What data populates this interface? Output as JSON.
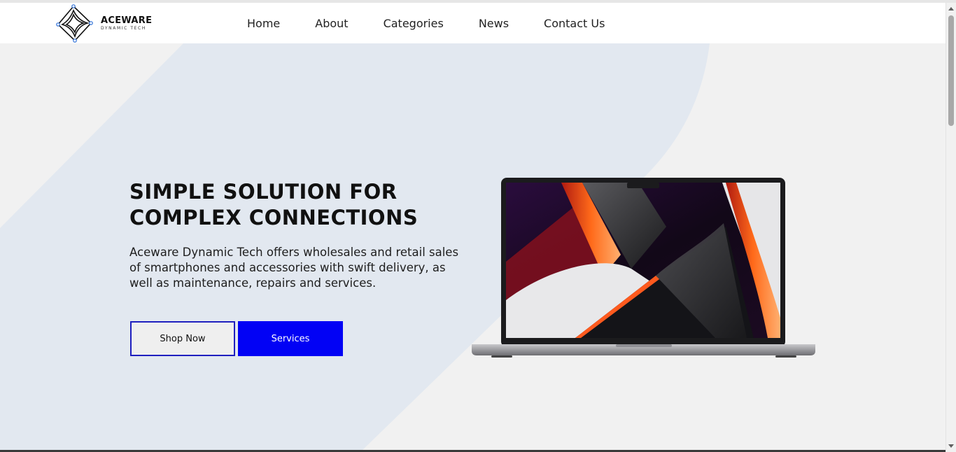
{
  "brand": {
    "name": "ACEWARE",
    "tagline": "DYNAMIC TECH"
  },
  "nav": {
    "items": [
      "Home",
      "About",
      "Categories",
      "News",
      "Contact Us"
    ]
  },
  "hero": {
    "headline_line1": "SIMPLE SOLUTION FOR",
    "headline_line2": "COMPLEX CONNECTIONS",
    "description": "Aceware Dynamic Tech offers wholesales and retail sales of smartphones and accessories with swift delivery, as well as maintenance, repairs and services.",
    "shop_button": "Shop Now",
    "services_button": "Services"
  },
  "colors": {
    "accent": "#0202f5",
    "outline": "#1f1fbf",
    "hero_shape": "#e2e8f0",
    "background": "#f1f1f1"
  },
  "icons": {
    "logo": "diamond-circuit-logo",
    "laptop": "macbook-laptop-image"
  }
}
